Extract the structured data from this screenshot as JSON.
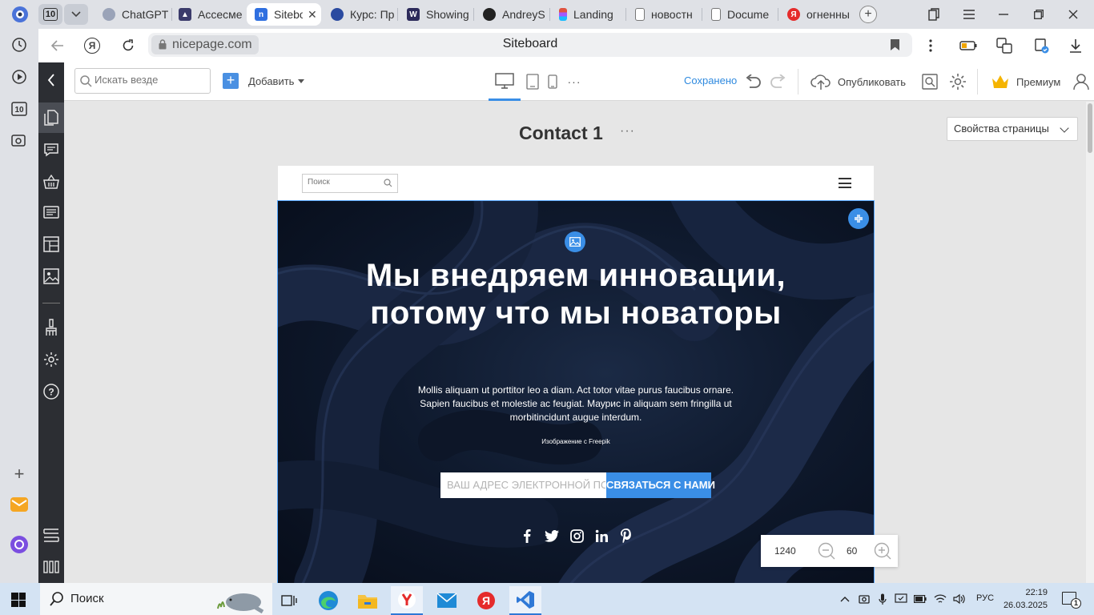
{
  "browser": {
    "tab_counter": "10",
    "tabs": [
      {
        "label": "ChatGPT",
        "favicon": "chatgpt-icon",
        "color": "#8a8fa0"
      },
      {
        "label": "Ассесмент",
        "favicon": "cap-icon",
        "color": "#3b3b6b"
      },
      {
        "label": "Siteboard",
        "favicon": "nicepage-icon",
        "color": "#2f6fe0",
        "active": true
      },
      {
        "label": "Курс: Пр",
        "favicon": "shield-icon",
        "color": "#2a4aa0"
      },
      {
        "label": "Showing",
        "favicon": "wolf-icon",
        "color": "#2c2a5a"
      },
      {
        "label": "AndreyS",
        "favicon": "github-icon",
        "color": "#222222"
      },
      {
        "label": "Landing",
        "favicon": "figma-icon",
        "color": "#e0533f"
      },
      {
        "label": "новостн",
        "favicon": "doc-icon",
        "color": "#777777"
      },
      {
        "label": "Docume",
        "favicon": "doc-icon",
        "color": "#777777"
      },
      {
        "label": "огненны",
        "favicon": "yandex-icon",
        "color": "#e52b2b"
      }
    ],
    "url_domain": "nicepage.com",
    "page_title": "Siteboard"
  },
  "toolbar": {
    "search_placeholder": "Искать везде",
    "add_label": "Добавить",
    "more_devices": "···",
    "saved_label": "Сохранено",
    "publish_label": "Опубликовать",
    "premium_label": "Премиум"
  },
  "canvas": {
    "page_name": "Contact 1",
    "page_more": "···",
    "page_props_label": "Свойства страницы"
  },
  "preview": {
    "search_placeholder": "Поиск",
    "hero_title": "Мы внедряем инновации, потому что мы новаторы",
    "hero_text": "Mollis aliquam ut porttitor leo a diam. Act totor vitae purus faucibus ornare. Sapien faucibus et molestie ac feugiat. Маурис in aliquam sem fringilla ut morbitincidunt augue interdum.",
    "image_credit": "Изображение с Freepik",
    "email_placeholder": "ВАШ АДРЕС ЭЛЕКТРОННОЙ ПОЧТЫ",
    "contact_button": "СВЯЗАТЬСЯ С НАМИ",
    "social_icons": [
      "facebook-icon",
      "twitter-icon",
      "instagram-icon",
      "linkedin-icon",
      "pinterest-icon"
    ]
  },
  "zoom": {
    "width_value": "1240",
    "zoom_value": "60"
  },
  "taskbar": {
    "search_label": "Поиск",
    "language": "РУС",
    "time": "22:19",
    "date": "26.03.2025",
    "notifications_count": "1"
  },
  "colors": {
    "accent": "#3a8ee6",
    "saved_text": "#2f8adf",
    "sidebar_bg": "#2c2e33",
    "hero_bg": "#0f1a2e"
  }
}
